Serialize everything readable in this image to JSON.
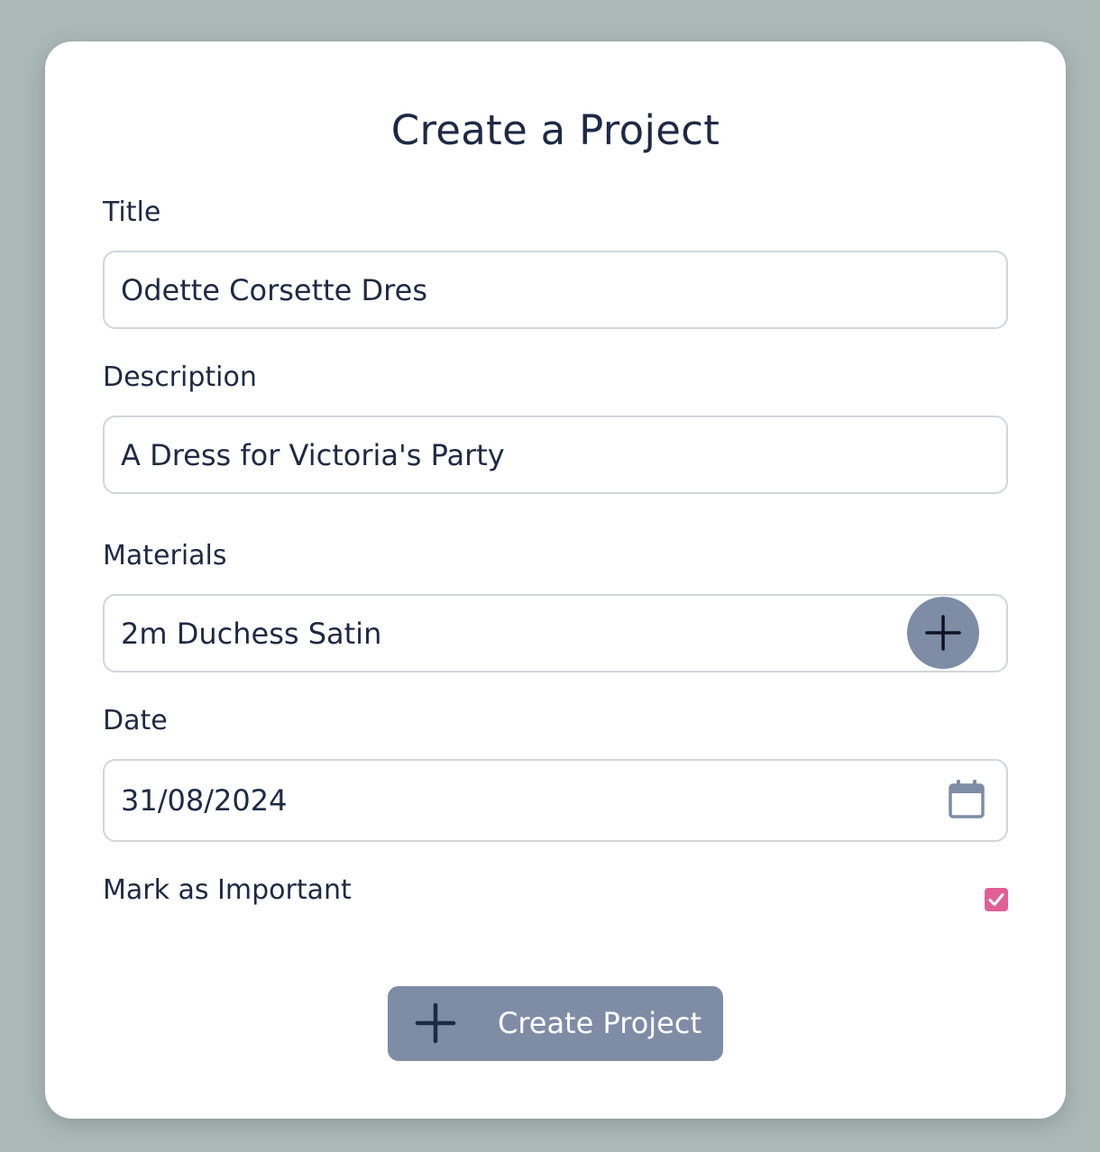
{
  "form": {
    "heading": "Create a Project",
    "title": {
      "label": "Title",
      "value": "Odette Corsette Dres"
    },
    "description": {
      "label": "Description",
      "value": "A Dress for Victoria's Party"
    },
    "materials": {
      "label": "Materials",
      "value": "2m Duchess Satin",
      "add_icon": "plus-icon"
    },
    "date": {
      "label": "Date",
      "value": "31/08/2024",
      "icon": "calendar-icon"
    },
    "important": {
      "label": "Mark as Important",
      "checked": true
    },
    "submit": {
      "label": "Create Project",
      "icon": "plus-icon"
    }
  },
  "colors": {
    "page_background": "#abb8b5",
    "card_background": "#ffffff",
    "text": "#1e2a44",
    "button": "#7e8ca6",
    "checkbox_accent": "#e06096",
    "field_border": "#d2d5d9"
  }
}
